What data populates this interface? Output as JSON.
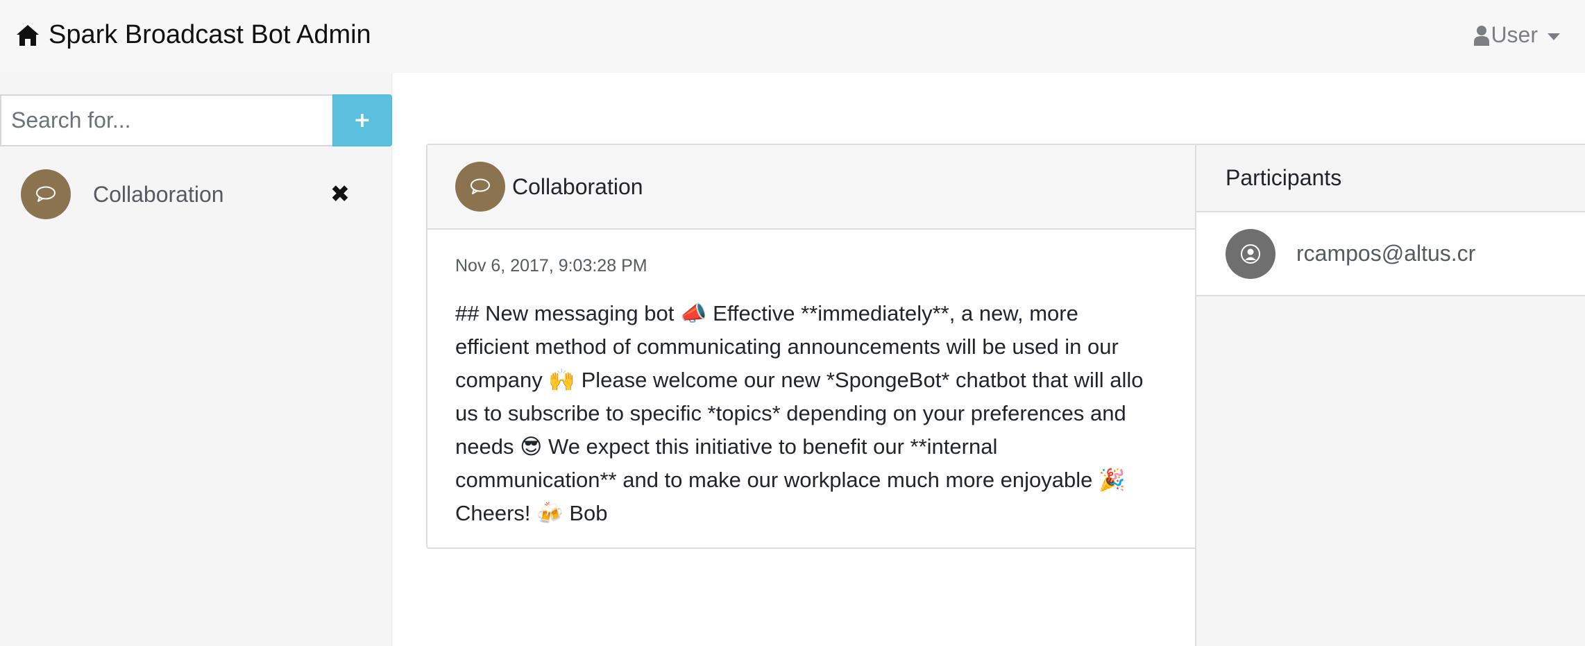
{
  "navbar": {
    "brand_icon": "home-icon",
    "brand_title": "Spark Broadcast Bot Admin",
    "user_icon": "user-icon",
    "user_label": "User"
  },
  "sidebar": {
    "search": {
      "placeholder": "Search for...",
      "value": ""
    },
    "add_button_label": "+",
    "topics": [
      {
        "icon": "chat-bubble-icon",
        "label": "Collaboration",
        "remove_glyph": "✖"
      }
    ]
  },
  "topic_card": {
    "icon": "chat-bubble-icon",
    "title": "Collaboration",
    "messages": [
      {
        "timestamp": "Nov 6, 2017, 9:03:28 PM",
        "lines": [
          "## New messaging bot 📣 Effective **immediately**, a new, more",
          "efficient method of communicating announcements will be used in our",
          "company 🙌 Please welcome our new *SpongeBot* chatbot that will allo",
          "us to subscribe to specific *topics* depending on your preferences and",
          "needs 😎 We expect this initiative to benefit our **internal",
          "communication** and to make our workplace much more enjoyable 🎉",
          "Cheers! 🍻 Bob"
        ]
      }
    ]
  },
  "participants": {
    "title": "Participants",
    "items": [
      {
        "icon": "user-circle-icon",
        "email": "rcampos@altus.cr"
      }
    ]
  },
  "colors": {
    "accent_info": "#5bc0de",
    "topic_avatar": "#8b734f",
    "participant_avatar": "#6f6f6f"
  }
}
